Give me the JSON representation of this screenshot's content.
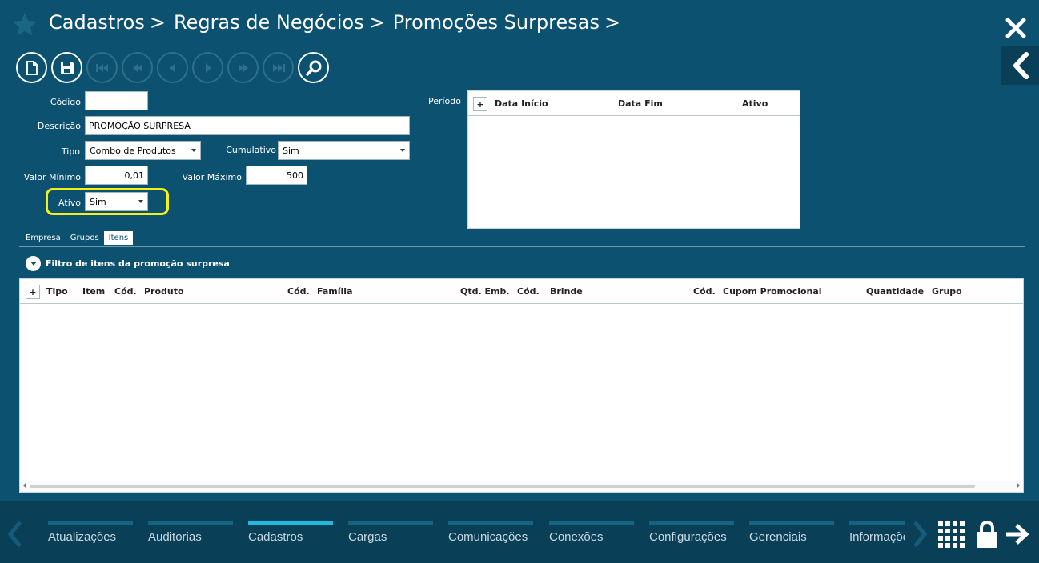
{
  "breadcrumb": [
    "Cadastros",
    "Regras de Negócios",
    "Promoções Surpresas"
  ],
  "form": {
    "codigo_label": "Código",
    "codigo_value": "",
    "descricao_label": "Descrição",
    "descricao_value": "PROMOÇÃO SURPRESA",
    "tipo_label": "Tipo",
    "tipo_value": "Combo de Produtos",
    "cumulativo_label": "Cumulativo",
    "cumulativo_value": "Sim",
    "valor_minimo_label": "Valor Mínimo",
    "valor_minimo_value": "0,01",
    "valor_maximo_label": "Valor Máximo",
    "valor_maximo_value": "500",
    "ativo_label": "Ativo",
    "ativo_value": "Sim"
  },
  "periodo": {
    "label": "Período",
    "add": "+",
    "columns": [
      "Data Início",
      "Data Fim",
      "Ativo"
    ]
  },
  "tabs": [
    "Empresa",
    "Grupos",
    "Itens"
  ],
  "active_tab": "Itens",
  "filter_label": "Filtro de itens da promoção surpresa",
  "items_grid": {
    "add": "+",
    "columns": [
      "Tipo",
      "Item",
      "Cód.",
      "Produto",
      "Cód.",
      "Família",
      "Qtd. Emb.",
      "Cód.",
      "Brinde",
      "Cód.",
      "Cupom Promocional",
      "Quantidade",
      "Grupo"
    ]
  },
  "bottom_menu": [
    "Atualizações",
    "Auditorias",
    "Cadastros",
    "Cargas",
    "Comunicações",
    "Conexões",
    "Configurações",
    "Gerenciais",
    "Informações"
  ],
  "active_menu": "Cadastros",
  "colors": {
    "background": "#0c5170",
    "bottom_bar": "#0a3f58",
    "menu_active": "#25b8dd",
    "highlight": "#f3f01c"
  }
}
